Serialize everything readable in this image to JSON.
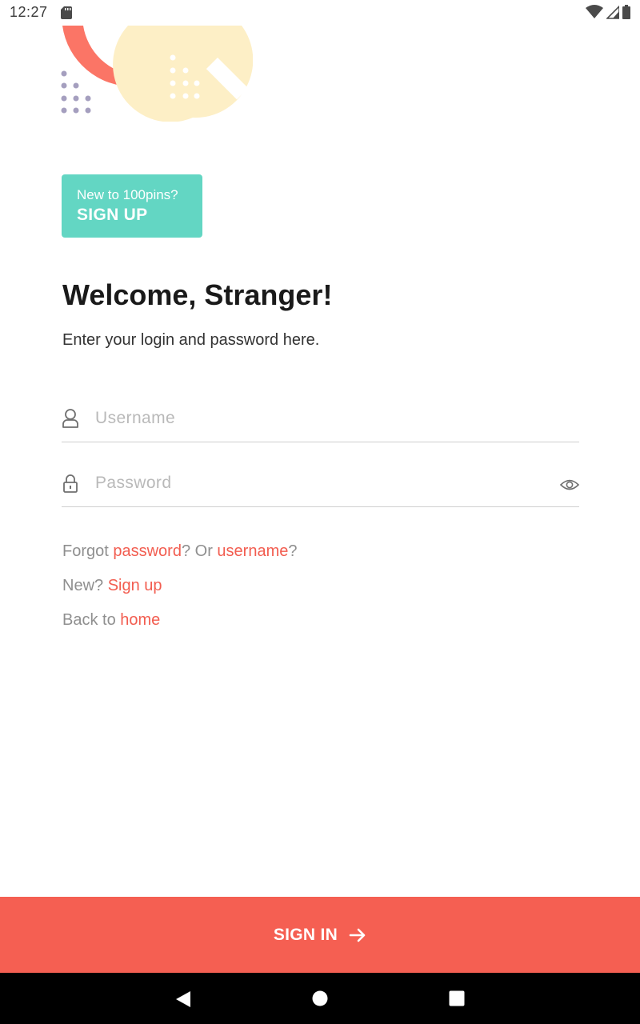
{
  "status_bar": {
    "time": "12:27"
  },
  "signup_card": {
    "prompt": "New to 100pins?",
    "action": "SIGN UP"
  },
  "header": {
    "title": "Welcome, Stranger!",
    "subtitle": "Enter your login and password here."
  },
  "form": {
    "username": {
      "placeholder": "Username",
      "value": ""
    },
    "password": {
      "placeholder": "Password",
      "value": ""
    }
  },
  "links": {
    "forgot_prefix": "Forgot ",
    "forgot_password": "password",
    "forgot_middle": "? Or ",
    "forgot_username": "username",
    "forgot_suffix": "?",
    "new_prefix": "New? ",
    "new_signup": "Sign up",
    "back_prefix": "Back to ",
    "back_home": "home"
  },
  "primary_action": {
    "label": "SIGN IN"
  },
  "colors": {
    "accent": "#f55f52",
    "teal": "#63d6c3",
    "peach": "#fdefc6",
    "coral": "#fb7566",
    "dots": "#a59fbf"
  },
  "icons": {
    "status": [
      "sd-card-icon",
      "wifi-icon",
      "signal-icon",
      "battery-icon"
    ],
    "fields": [
      "user-icon",
      "lock-icon",
      "eye-icon"
    ],
    "nav": [
      "back-icon",
      "home-icon",
      "recents-icon"
    ]
  }
}
